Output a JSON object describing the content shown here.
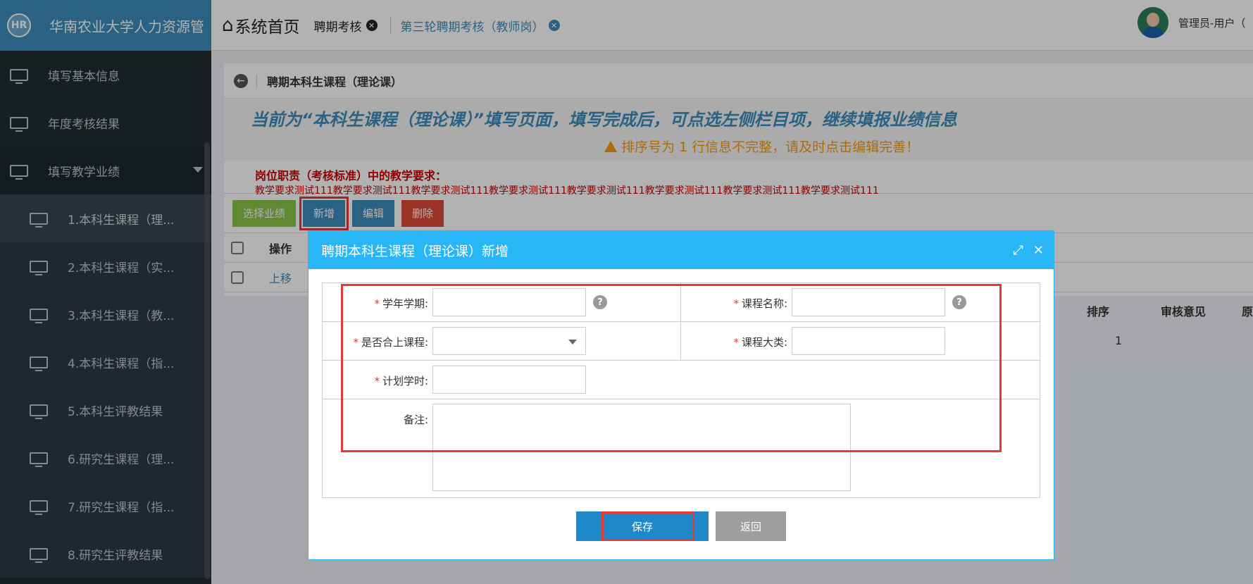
{
  "header": {
    "logo_text": "HR",
    "system_name": "华南农业大学人力资源管",
    "home_label": "系统首页",
    "home_icon": "home-icon",
    "tabs": [
      {
        "label": "聘期考核"
      },
      {
        "label": "第三轮聘期考核（教师岗）"
      }
    ],
    "user_label": "管理员-用户（"
  },
  "sidebar": {
    "items": [
      {
        "label": "填写基本信息"
      },
      {
        "label": "年度考核结果"
      },
      {
        "label": "填写教学业绩"
      },
      {
        "label": "1.本科生课程（理..."
      },
      {
        "label": "2.本科生课程（实..."
      },
      {
        "label": "3.本科生课程（教..."
      },
      {
        "label": "4.本科生课程（指..."
      },
      {
        "label": "5.本科生评教结果"
      },
      {
        "label": "6.研究生课程（理..."
      },
      {
        "label": "7.研究生课程（指..."
      },
      {
        "label": "8.研究生评教结果"
      }
    ]
  },
  "page": {
    "breadcrumb_title": "聘期本科生课程（理论课）",
    "headline": "当前为“本科生课程（理论课）”填写页面，填写完成后，可点选左侧栏目项，继续填报业绩信息",
    "warning": "排序号为 1 行信息不完整，请及时点击编辑完善！",
    "requirement_title": "岗位职责（考核标准）中的教学要求：",
    "requirement_text": "教学要求测试111教学要求测试111教学要求测试111教学要求测试111教学要求测试111教学要求测试111教学要求测试111教学要求测试111",
    "buttons": {
      "select": "选择业绩",
      "add": "新增",
      "edit": "编辑",
      "delete": "删除"
    },
    "table": {
      "headers": {
        "op": "操作",
        "order": "排序",
        "review": "审核意见",
        "reason": "原"
      },
      "rows": [
        {
          "op": "上移",
          "order": "1"
        }
      ]
    }
  },
  "modal": {
    "title": "聘期本科生课程（理论课）新增",
    "fields": {
      "term_label": "学年学期:",
      "course_name_label": "课程名称:",
      "joint_label": "是否合上课程:",
      "category_label": "课程大类:",
      "hours_label": "计划学时:",
      "remark_label": "备注:"
    },
    "values": {
      "term": "",
      "course_name": "",
      "joint": "",
      "category": "",
      "hours": "",
      "remark": ""
    },
    "save_label": "保存",
    "back_label": "返回"
  }
}
